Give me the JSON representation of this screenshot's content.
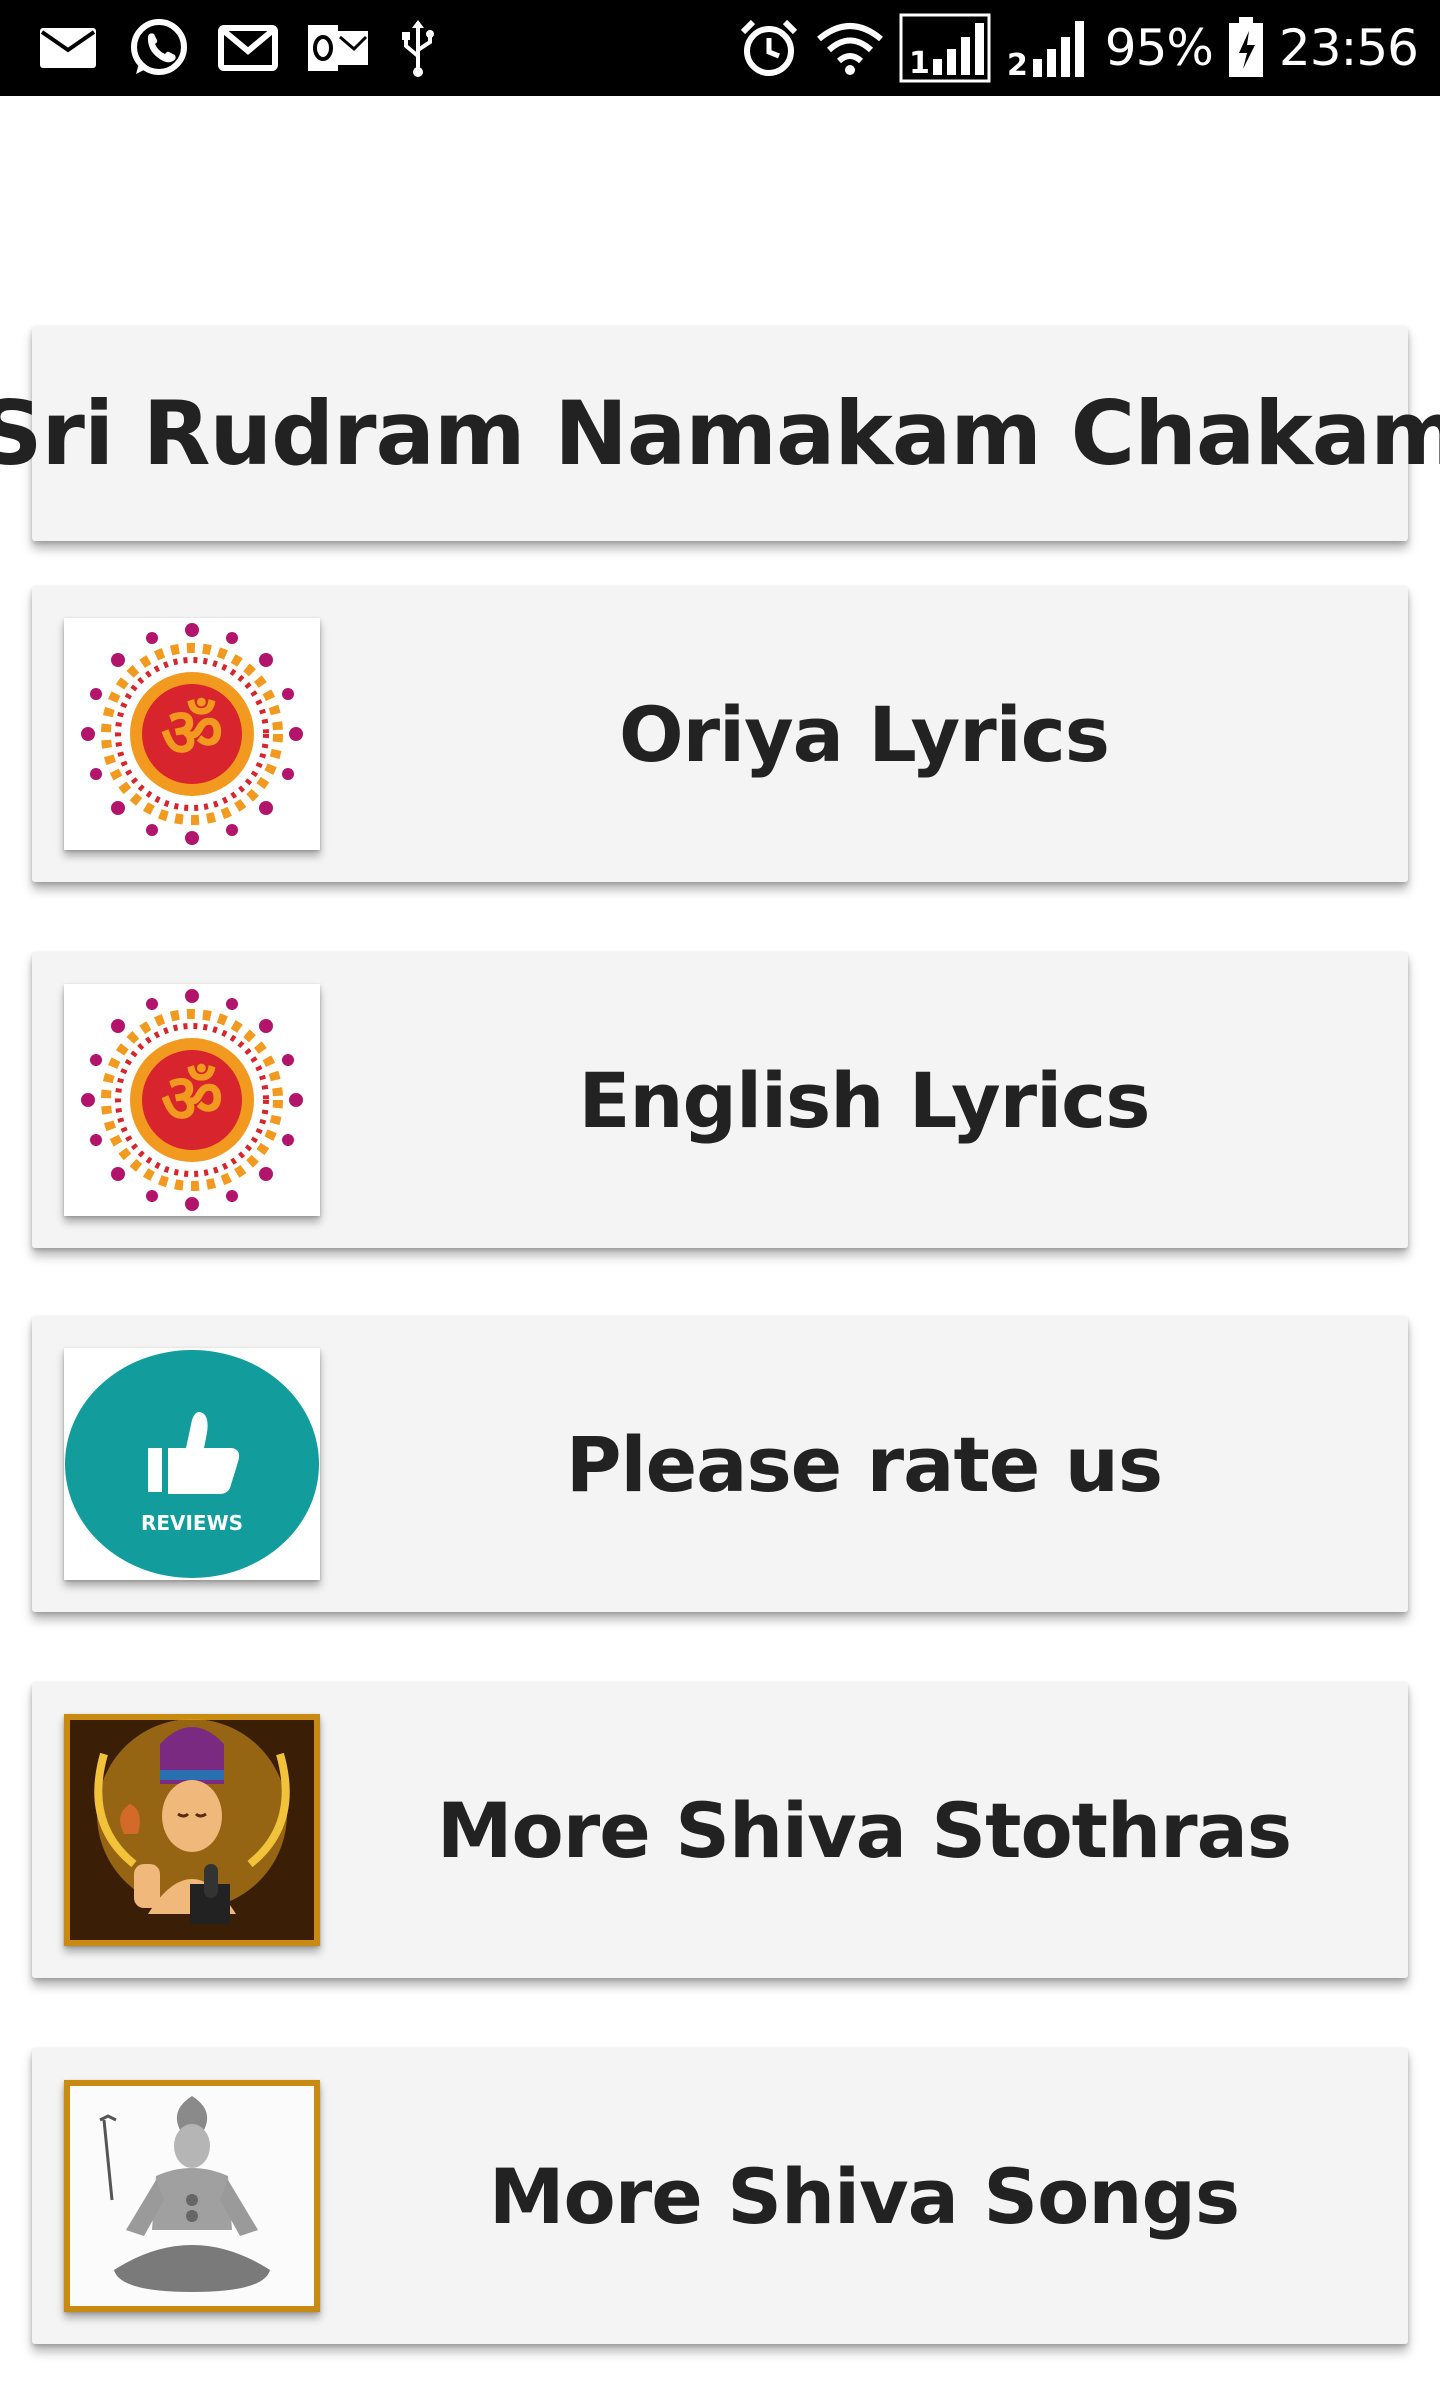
{
  "status_bar": {
    "icons_left": [
      "email-icon",
      "whatsapp-icon",
      "gmail-icon",
      "outlook-icon",
      "usb-icon"
    ],
    "icons_right": [
      "alarm-icon",
      "wifi-icon",
      "signal-sim1-icon",
      "signal-sim2-icon"
    ],
    "battery_percent": "95%",
    "time": "23:56"
  },
  "header": {
    "title": "Sri Rudram Namakam Chakam"
  },
  "menu": {
    "items": [
      {
        "label": "Oriya Lyrics",
        "icon": "om-mandala-icon"
      },
      {
        "label": "English Lyrics",
        "icon": "om-mandala-icon"
      },
      {
        "label": "Please rate us",
        "icon": "reviews-thumbs-up-icon",
        "icon_text": "REVIEWS"
      },
      {
        "label": "More Shiva Stothras",
        "icon": "shiva-portrait-icon"
      },
      {
        "label": "More Shiva Songs",
        "icon": "shiva-meditating-icon"
      }
    ]
  },
  "colors": {
    "status_bar_bg": "#000000",
    "card_bg": "#f4f4f4",
    "text": "#222222",
    "reviews_teal": "#139c9c",
    "om_red": "#d8242c",
    "om_orange": "#f29a1f",
    "om_magenta": "#b3146b",
    "frame_gold": "#c98a12"
  }
}
